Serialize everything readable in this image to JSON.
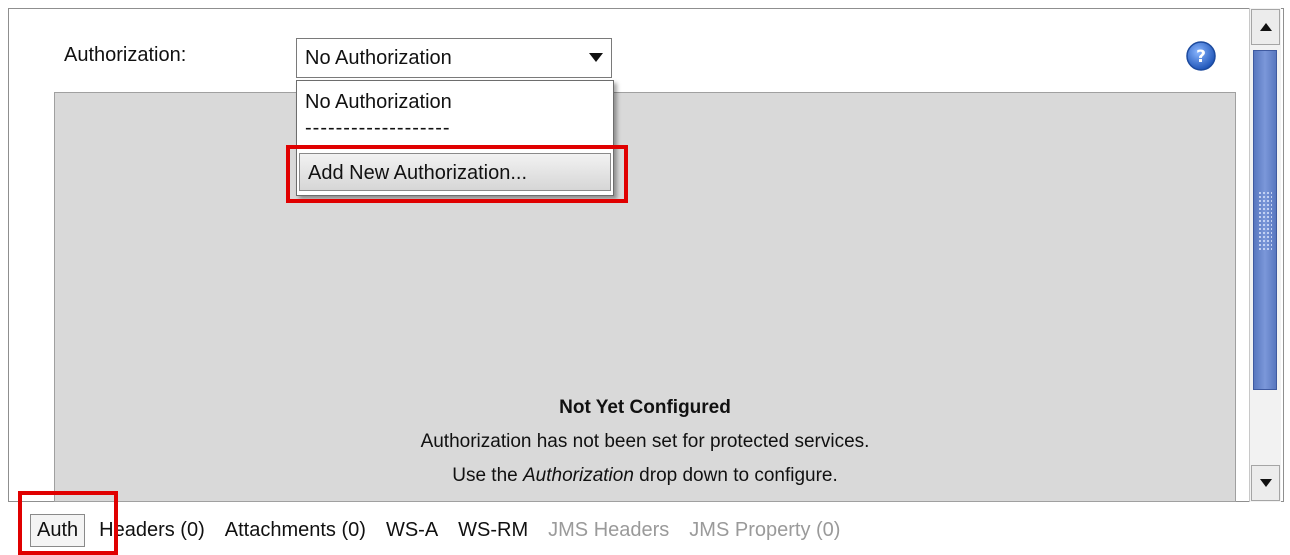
{
  "authorization": {
    "label": "Authorization:",
    "selected": "No Authorization",
    "options": [
      "No Authorization",
      "-------------------",
      "Add New Authorization..."
    ]
  },
  "panel": {
    "title": "Not Yet Configured",
    "line1": "Authorization has not been set for protected services.",
    "line2_prefix": "Use the ",
    "line2_em": "Authorization",
    "line2_suffix": " drop down to configure."
  },
  "tabs": [
    {
      "label": "Auth",
      "enabled": true
    },
    {
      "label": "Headers (0)",
      "enabled": true
    },
    {
      "label": "Attachments (0)",
      "enabled": true
    },
    {
      "label": "WS-A",
      "enabled": true
    },
    {
      "label": "WS-RM",
      "enabled": true
    },
    {
      "label": "JMS Headers",
      "enabled": false
    },
    {
      "label": "JMS Property (0)",
      "enabled": false
    }
  ],
  "icons": {
    "help": "help-icon",
    "dropdown": "chevron-down-icon",
    "scroll_up": "arrow-up-icon",
    "scroll_down": "arrow-down-icon"
  },
  "colors": {
    "highlight": "#e00000",
    "help_blue": "#2f6fd0",
    "scroll_thumb": "#6784cc"
  }
}
